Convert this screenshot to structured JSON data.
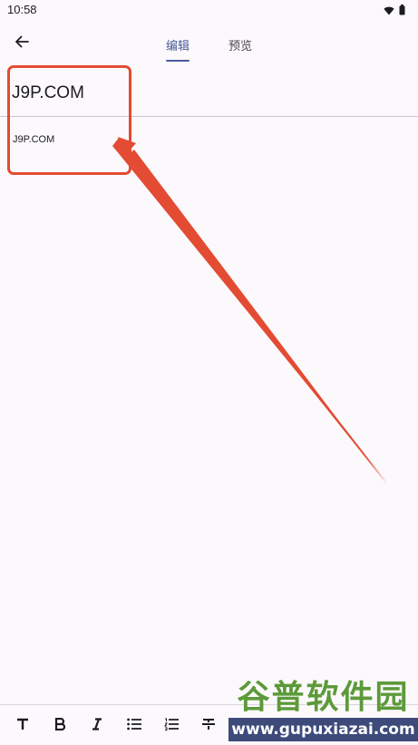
{
  "status_bar": {
    "time": "10:58",
    "icons": [
      "wifi-icon",
      "battery-icon"
    ]
  },
  "app_bar": {
    "back_icon": "arrow-left-icon",
    "tabs": [
      {
        "label": "编辑",
        "active": true
      },
      {
        "label": "预览",
        "active": false
      }
    ],
    "accent_color": "#4a5a9a"
  },
  "editor": {
    "title_value": "J9P.COM",
    "body_value": "J9P.COM"
  },
  "annotation": {
    "color": "#e34b33"
  },
  "toolbar": {
    "tools": [
      {
        "name": "text-size-icon",
        "glyph": "T"
      },
      {
        "name": "bold-icon",
        "glyph": "B"
      },
      {
        "name": "italic-icon",
        "glyph": "I"
      },
      {
        "name": "bullet-list-icon",
        "glyph": "☰"
      },
      {
        "name": "numbered-list-icon",
        "glyph": "☰"
      },
      {
        "name": "strikethrough-icon",
        "glyph": "S"
      }
    ]
  },
  "watermark": {
    "top_text": "谷普软件园",
    "bottom_text": "www.gupuxiazai.com"
  }
}
